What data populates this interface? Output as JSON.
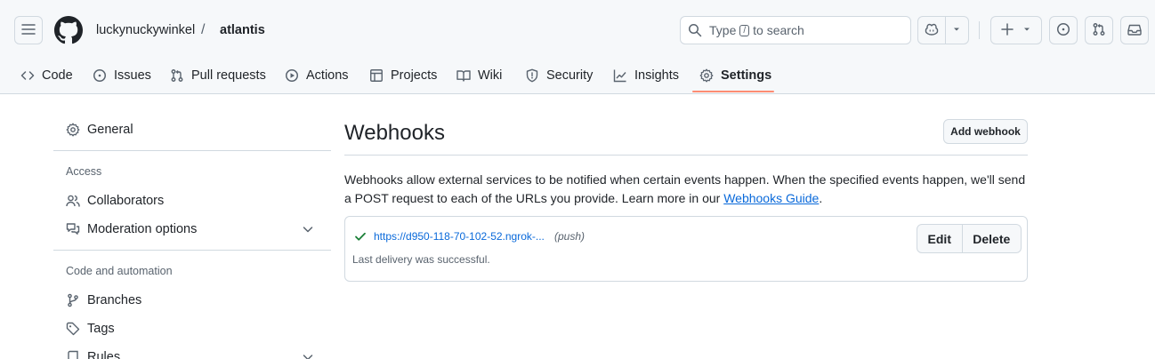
{
  "header": {
    "owner": "luckynuckywinkel",
    "separator": "/",
    "repo": "atlantis",
    "search": {
      "prefix": "Type",
      "key": "/",
      "suffix": "to search"
    },
    "icons": [
      "hamburger-icon",
      "github-logo",
      "search-icon",
      "copilot-icon",
      "chevron-down-icon",
      "plus-icon",
      "issue-icon",
      "pull-request-icon",
      "inbox-icon"
    ]
  },
  "nav": {
    "tabs": [
      {
        "label": "Code",
        "icon": "code-icon"
      },
      {
        "label": "Issues",
        "icon": "issue-icon"
      },
      {
        "label": "Pull requests",
        "icon": "pull-request-icon"
      },
      {
        "label": "Actions",
        "icon": "play-icon"
      },
      {
        "label": "Projects",
        "icon": "table-icon"
      },
      {
        "label": "Wiki",
        "icon": "book-icon"
      },
      {
        "label": "Security",
        "icon": "shield-icon"
      },
      {
        "label": "Insights",
        "icon": "graph-icon"
      },
      {
        "label": "Settings",
        "icon": "gear-icon",
        "selected": true
      }
    ],
    "accent": "#fd8c73"
  },
  "sidebar": {
    "general": "General",
    "access_heading": "Access",
    "collaborators": "Collaborators",
    "moderation": "Moderation options",
    "code_heading": "Code and automation",
    "branches": "Branches",
    "tags": "Tags",
    "rules": "Rules"
  },
  "main": {
    "title": "Webhooks",
    "add_button": "Add webhook",
    "description": "Webhooks allow external services to be notified when certain events happen. When the specified events happen, we'll send a POST request to each of the URLs you provide. Learn more in our",
    "guide_link": "Webhooks Guide",
    "period": ".",
    "webhook": {
      "url": "https://d950-118-70-102-52.ngrok-...",
      "events": "(push)",
      "status": "Last delivery was successful.",
      "edit": "Edit",
      "delete": "Delete",
      "status_color": "#1a7f37"
    },
    "link_color": "#0969da"
  }
}
